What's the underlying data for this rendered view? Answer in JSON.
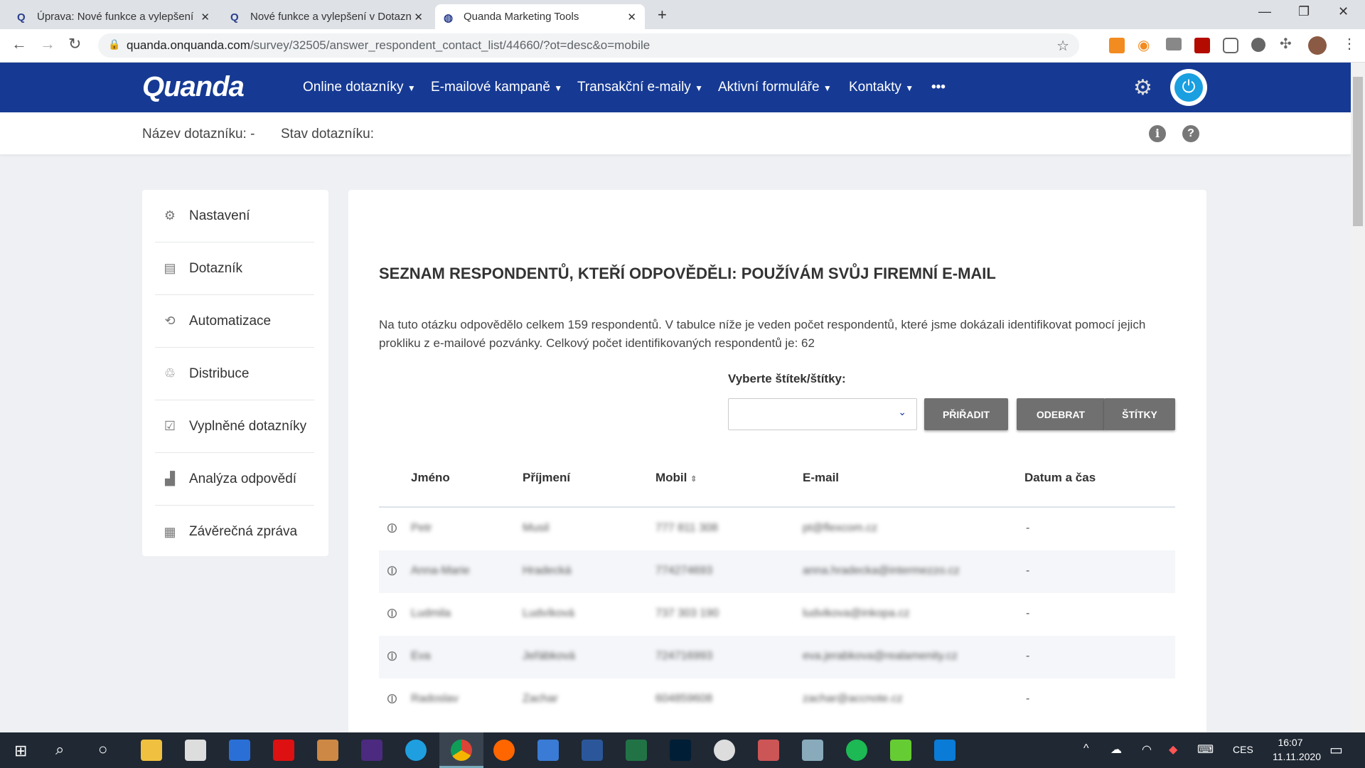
{
  "browser": {
    "tabs": [
      {
        "title": "Úprava: Nové funkce a vylepšení"
      },
      {
        "title": "Nové funkce a vylepšení v Dotazn"
      },
      {
        "title": "Quanda Marketing Tools"
      }
    ],
    "url_host": "quanda.onquanda.com",
    "url_path": "/survey/32505/answer_respondent_contact_list/44660/?ot=desc&o=mobile"
  },
  "nav": {
    "logo": "Quanda",
    "items": [
      "Online dotazníky",
      "E-mailové kampaně",
      "Transakční e-maily",
      "Aktivní formuláře",
      "Kontakty"
    ],
    "more": "•••"
  },
  "subheader": {
    "name_label": "Název dotazníku:",
    "name_value": "-",
    "status_label": "Stav dotazníku:"
  },
  "sidebar": {
    "items": [
      {
        "label": "Nastavení",
        "icon": "gear-icon"
      },
      {
        "label": "Dotazník",
        "icon": "document-icon"
      },
      {
        "label": "Automatizace",
        "icon": "refresh-icon"
      },
      {
        "label": "Distribuce",
        "icon": "distribution-icon"
      },
      {
        "label": "Vyplněné dotazníky",
        "icon": "checklist-icon"
      },
      {
        "label": "Analýza odpovědí",
        "icon": "bar-chart-icon"
      },
      {
        "label": "Závěrečná zpráva",
        "icon": "report-icon"
      }
    ]
  },
  "main": {
    "title": "SEZNAM RESPONDENTŮ, KTEŘÍ ODPOVĚDĚLI: POUŽÍVÁM SVŮJ FIREMNÍ E-MAIL",
    "description": "Na tuto otázku odpovědělo celkem 159 respondentů. V tabulce níže je veden počet respondentů, které jsme dokázali identifikovat pomocí jejich prokliku z e-mailové pozvánky. Celkový počet identifikovaných respondentů je: 62",
    "tag_label": "Vyberte štítek/štítky:",
    "assign": "PŘIŘADIT",
    "remove": "ODEBRAT",
    "tags": "ŠTÍTKY"
  },
  "table": {
    "headers": [
      "Jméno",
      "Příjmení",
      "Mobil",
      "E-mail",
      "Datum a čas"
    ],
    "rows": [
      {
        "first": "Petr",
        "last": "Musil",
        "mobile": "777 811 308",
        "email": "pt@flexcom.cz",
        "date": "-"
      },
      {
        "first": "Anna-Marie",
        "last": "Hradecká",
        "mobile": "774274693",
        "email": "anna.hradecka@intermezzo.cz",
        "date": "-"
      },
      {
        "first": "Ludmila",
        "last": "Ludvíková",
        "mobile": "737 303 190",
        "email": "ludvikova@inkopa.cz",
        "date": "-"
      },
      {
        "first": "Eva",
        "last": "Jeřábková",
        "mobile": "724716993",
        "email": "eva.jerabkova@realamenity.cz",
        "date": "-"
      },
      {
        "first": "Radoslav",
        "last": "Zachar",
        "mobile": "604859608",
        "email": "zachar@accnote.cz",
        "date": "-"
      }
    ]
  },
  "taskbar": {
    "lang": "CES",
    "time": "16:07",
    "date": "11.11.2020"
  }
}
